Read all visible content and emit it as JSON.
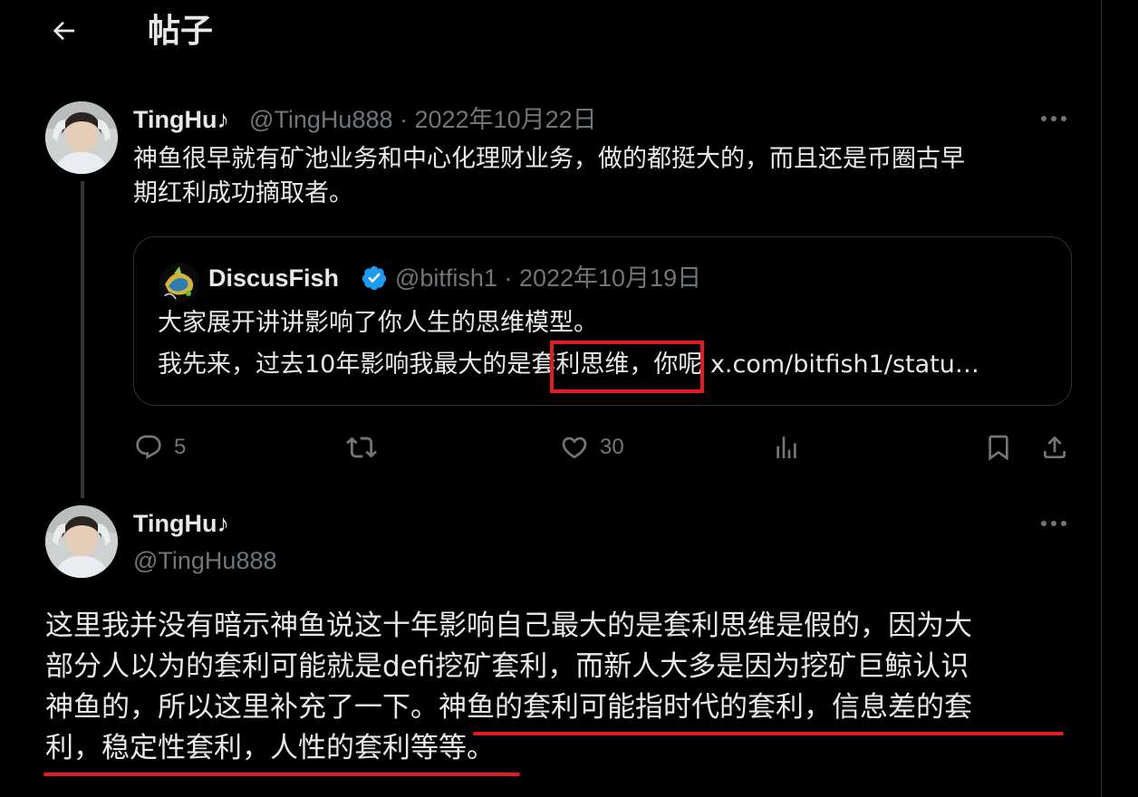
{
  "header": {
    "title": "帖子",
    "back_icon": "arrow-left-icon"
  },
  "colors": {
    "background": "#000000",
    "text": "#e7e9ea",
    "muted": "#71767b",
    "border": "#2f3336",
    "verified": "#1d9bf0",
    "annotation": "#e31b23"
  },
  "tweet": {
    "display_name": "TingHu♪",
    "meta": "@TingHu888 · 2022年10月22日",
    "text_lines": [
      "神鱼很早就有矿池业务和中心化理财业务，做的都挺大的，而且还是币圈古早",
      "期红利成功摘取者。"
    ],
    "quote": {
      "display_name": "DiscusFish",
      "meta": "@bitfish1 · 2022年10月19日",
      "line1": "大家展开讲讲影响了你人生的思维模型。",
      "line2": "我先来，过去10年影响我最大的是套利思维，你呢 x.com/bitfish1/statu…"
    },
    "actions": {
      "reply_count": "5",
      "retweet_count": "",
      "like_count": "30"
    }
  },
  "reply": {
    "display_name": "TingHu♪",
    "handle": "@TingHu888",
    "body_lines": [
      "这里我并没有暗示神鱼说这十年影响自己最大的是套利思维是假的，因为大",
      "部分人以为的套利可能就是defi挖矿套利，而新人大多是因为挖矿巨鲸认识",
      "神鱼的，所以这里补充了一下。神鱼的套利可能指时代的套利，信息差的套",
      "利，稳定性套利，人性的套利等等。"
    ]
  }
}
